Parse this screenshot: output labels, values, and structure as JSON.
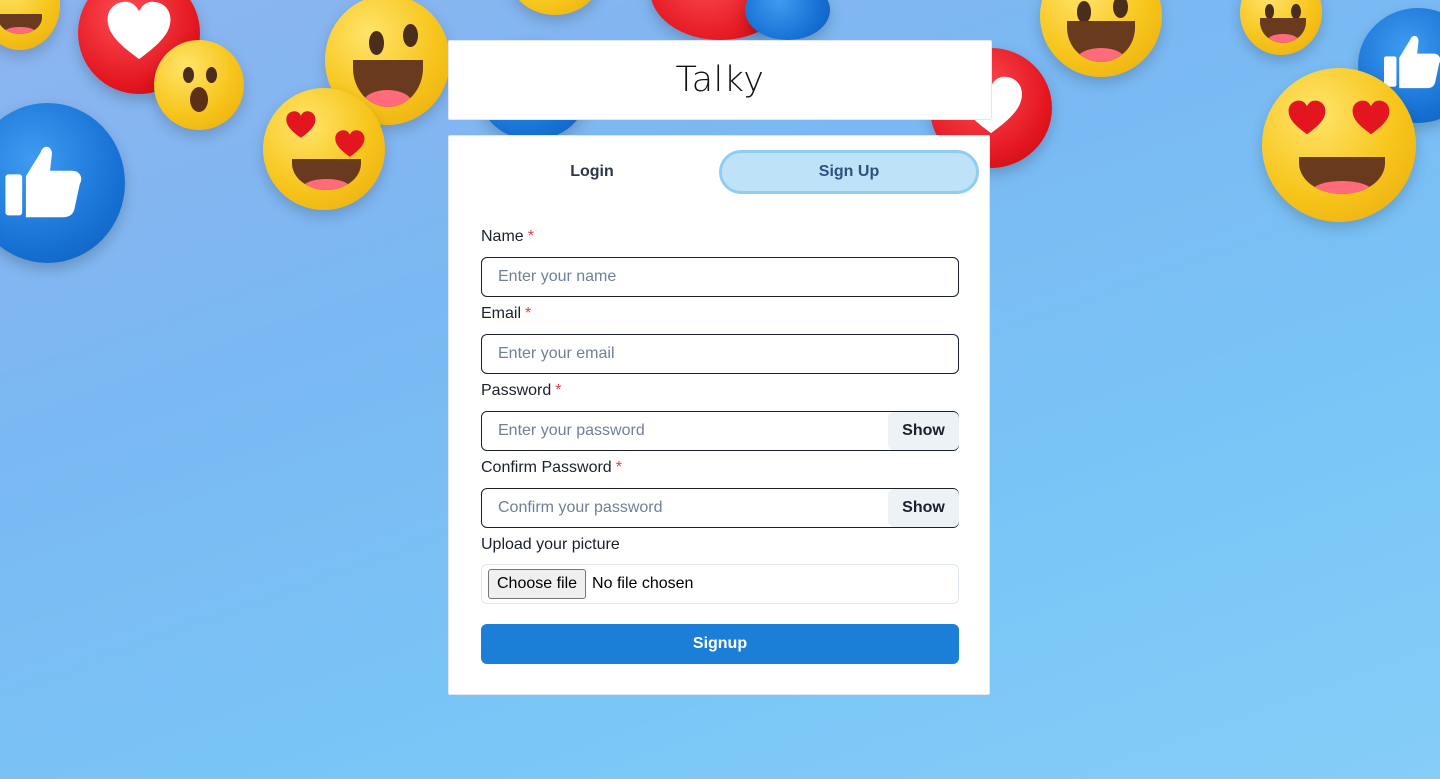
{
  "app": {
    "title": "Talky"
  },
  "tabs": [
    {
      "label": "Login",
      "active": false
    },
    {
      "label": "Sign Up",
      "active": true
    }
  ],
  "form": {
    "name": {
      "label": "Name",
      "required_mark": "*",
      "placeholder": "Enter your name",
      "value": ""
    },
    "email": {
      "label": "Email",
      "required_mark": "*",
      "placeholder": "Enter your email",
      "value": ""
    },
    "password": {
      "label": "Password",
      "required_mark": "*",
      "placeholder": "Enter your password",
      "value": "",
      "toggle_label": "Show"
    },
    "confirm_password": {
      "label": "Confirm Password",
      "required_mark": "*",
      "placeholder": "Confirm your password",
      "value": "",
      "toggle_label": "Show"
    },
    "picture": {
      "label": "Upload your picture",
      "button_label": "Choose file",
      "status": "No file chosen"
    },
    "submit_label": "Signup"
  },
  "colors": {
    "primary": "#1b7fd8",
    "active_tab_bg": "#bee3f8",
    "active_tab_border": "#90cdf4",
    "required": "#e53e3e"
  },
  "background": {
    "theme": "emoji-reactions",
    "icons": [
      "laughing-emoji-icon",
      "heart-eyes-emoji-icon",
      "wow-emoji-icon",
      "thumbs-up-icon",
      "heart-reaction-icon"
    ]
  }
}
